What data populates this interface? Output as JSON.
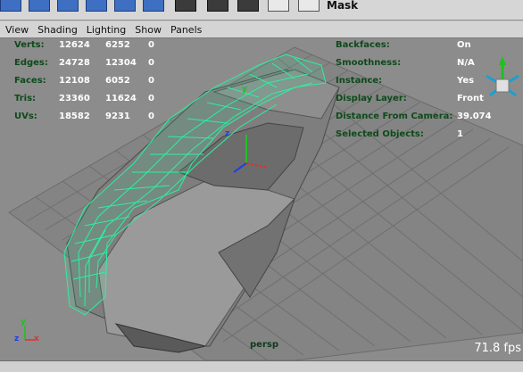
{
  "toolbar": {
    "mask_label": "Mask"
  },
  "menu": {
    "items": [
      "View",
      "Shading",
      "Lighting",
      "Show",
      "Panels"
    ]
  },
  "hud": {
    "stats": [
      {
        "label": "Verts:",
        "a": "12624",
        "b": "6252",
        "c": "0"
      },
      {
        "label": "Edges:",
        "a": "24728",
        "b": "12304",
        "c": "0"
      },
      {
        "label": "Faces:",
        "a": "12108",
        "b": "6052",
        "c": "0"
      },
      {
        "label": "Tris:",
        "a": "23360",
        "b": "11624",
        "c": "0"
      },
      {
        "label": "UVs:",
        "a": "18582",
        "b": "9231",
        "c": "0"
      }
    ],
    "right": [
      {
        "label": "Backfaces:",
        "value": "On"
      },
      {
        "label": "Smoothness:",
        "value": "N/A"
      },
      {
        "label": "Instance:",
        "value": "Yes"
      },
      {
        "label": "Display Layer:",
        "value": "Front"
      },
      {
        "label": "Distance From Camera:",
        "value": "39.074"
      },
      {
        "label": "Selected Objects:",
        "value": "1"
      }
    ],
    "camera_name": "persp",
    "fps": "71.8 fps"
  },
  "axes": {
    "x": "x",
    "y": "y",
    "z": "z"
  },
  "colors": {
    "viewport_bg": "#8c8c8c",
    "grid": "#6f6f6f",
    "wireframe": "#2df0a0",
    "hud_text": "#0d4a1a",
    "axis_x": "#e03030",
    "axis_y": "#20c020",
    "axis_z": "#2040e0"
  }
}
